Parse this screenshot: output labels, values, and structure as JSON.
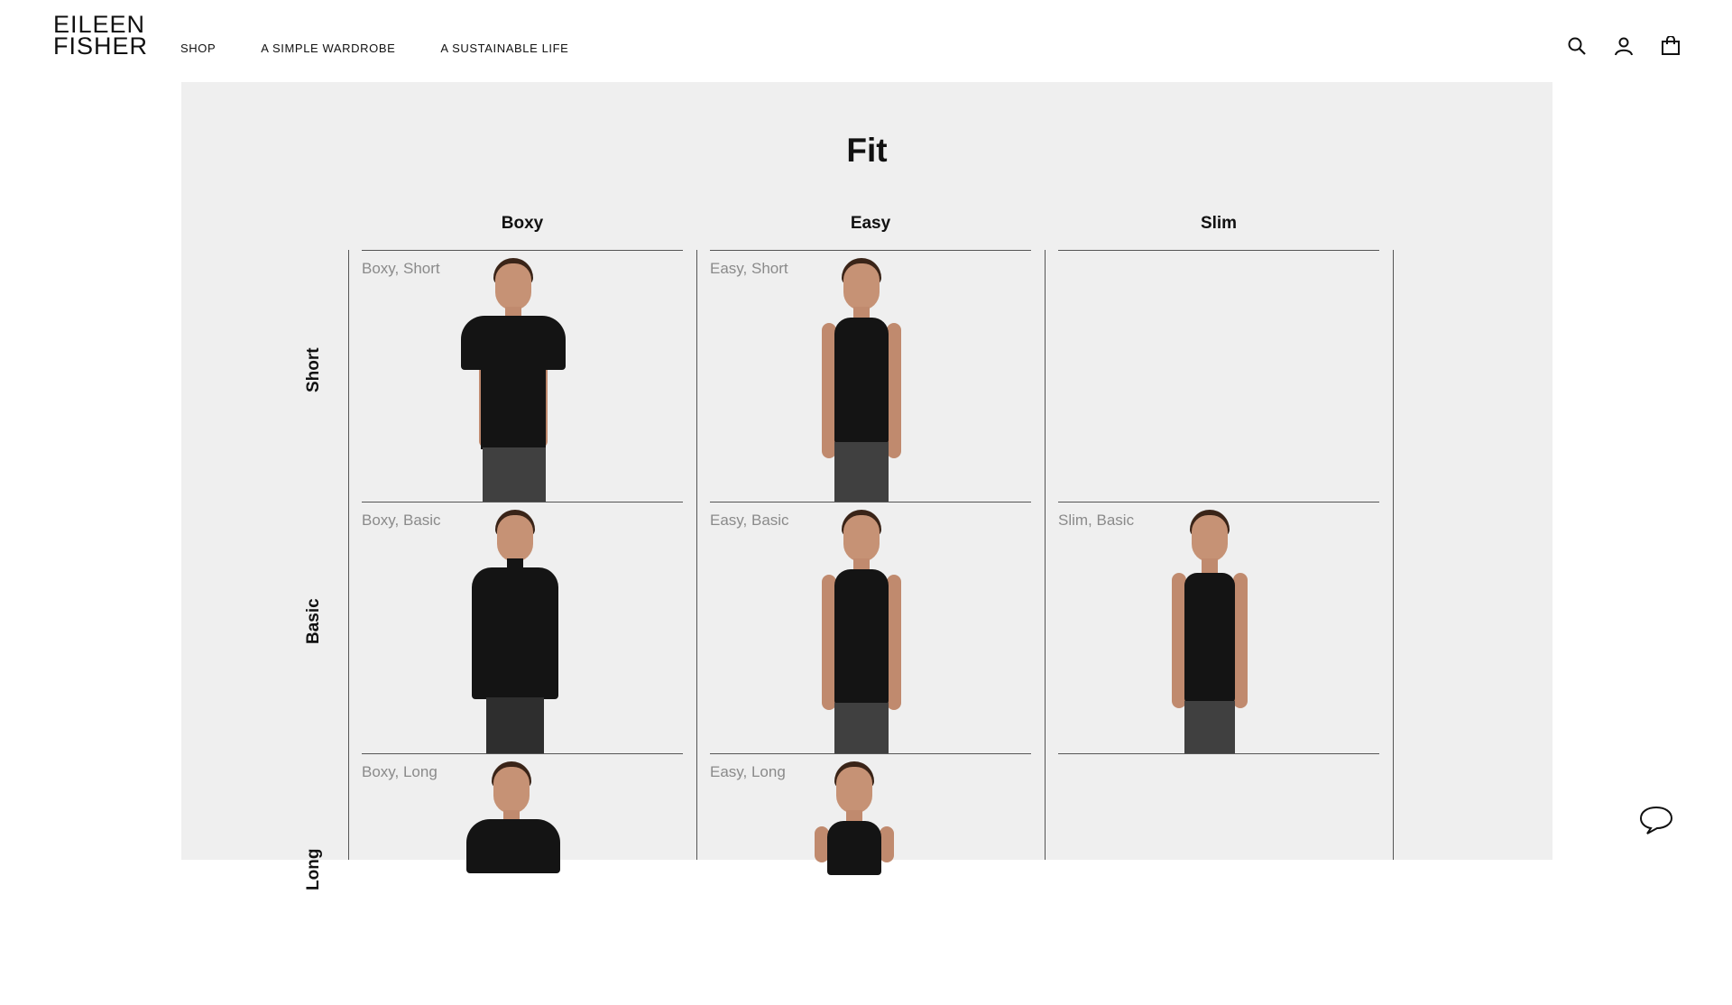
{
  "brand": {
    "line1": "EILEEN",
    "line2": "FISHER"
  },
  "nav": {
    "shop": "SHOP",
    "wardrobe": "A SIMPLE WARDROBE",
    "sustainable": "A SUSTAINABLE LIFE"
  },
  "header_icons": [
    "search-icon",
    "account-icon",
    "bag-icon"
  ],
  "fit": {
    "title": "Fit",
    "columns": [
      "Boxy",
      "Easy",
      "Slim"
    ],
    "rows": [
      "Short",
      "Basic",
      "Long"
    ],
    "cells": {
      "boxy_short": "Boxy, Short",
      "easy_short": "Easy, Short",
      "boxy_basic": "Boxy, Basic",
      "easy_basic": "Easy, Basic",
      "slim_basic": "Slim, Basic",
      "boxy_long": "Boxy, Long",
      "easy_long": "Easy, Long"
    }
  },
  "colors": {
    "panel_bg": "#efefef",
    "text": "#111111",
    "label_gray": "#8a8a8a",
    "rule": "#555555"
  },
  "chat_icon": "chat-bubble-icon"
}
